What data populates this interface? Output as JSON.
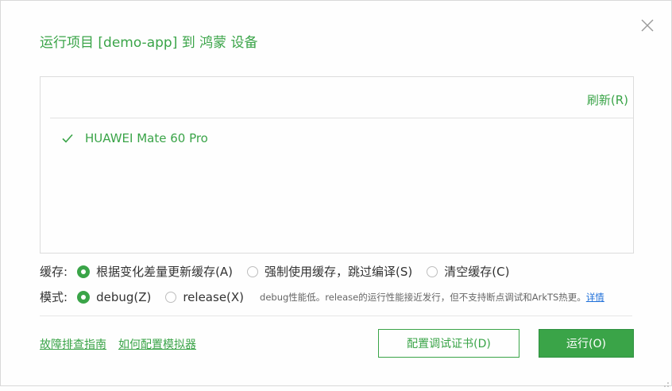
{
  "dialog": {
    "title": "运行项目 [demo-app] 到 鸿蒙 设备"
  },
  "device_panel": {
    "refresh_label": "刷新(R)",
    "devices": [
      {
        "name": "HUAWEI Mate 60 Pro",
        "selected": true
      }
    ]
  },
  "cache": {
    "label": "缓存:",
    "options": [
      {
        "label": "根据变化差量更新缓存(A)",
        "selected": true
      },
      {
        "label": "强制使用缓存，跳过编译(S)",
        "selected": false
      },
      {
        "label": "清空缓存(C)",
        "selected": false
      }
    ]
  },
  "mode": {
    "label": "模式:",
    "options": [
      {
        "label": "debug(Z)",
        "selected": true
      },
      {
        "label": "release(X)",
        "selected": false
      }
    ],
    "note": "debug性能低。release的运行性能接近发行，但不支持断点调试和ArkTS热更。",
    "detail_link": "详情"
  },
  "footer": {
    "troubleshoot_link": "故障排查指南",
    "emulator_link": "如何配置模拟器",
    "cert_button": "配置调试证书(D)",
    "run_button": "运行(O)"
  },
  "colors": {
    "accent": "#3aa448",
    "link_blue": "#1e6fd9",
    "border": "#dcdcdc"
  }
}
